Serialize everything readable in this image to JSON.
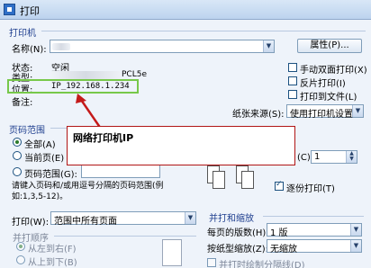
{
  "window": {
    "title": "打印"
  },
  "printer_group": {
    "title": "打印机",
    "name_label": "名称(N):",
    "properties_button": "属性(P)...",
    "status_label": "状态:",
    "status_value": "空闲",
    "type_label": "类型:",
    "type_value": "PCL5e",
    "where_label": "位置:",
    "where_value": "IP_192.168.1.234",
    "comment_label": "备注:",
    "checkboxes": [
      {
        "label": "手动双面打印(X)",
        "checked": false
      },
      {
        "label": "反片打印(I)",
        "checked": false
      },
      {
        "label": "打印到文件(L)",
        "checked": false
      }
    ],
    "paper_source_label": "纸张来源(S):",
    "paper_source_value": "使用打印机设置"
  },
  "annotation": {
    "text": "网络打印机IP"
  },
  "page_range": {
    "title": "页码范围",
    "all": "全部(A)",
    "current": "当前页(E)",
    "pages": "页码范围(G):",
    "hint": "请键入页码和/或用逗号分隔的页码范围(例如:1,3,5-12)。"
  },
  "copies": {
    "partial_label": "(C):",
    "value": "1",
    "collate": "逐份打印(T)"
  },
  "print_what": {
    "label": "打印(W):",
    "value": "范围中所有页面"
  },
  "order": {
    "title": "并打顺序",
    "ltr": "从左到右(F)",
    "ttb": "从上到下(B)"
  },
  "zoom": {
    "title": "并打和缩放",
    "pages_per_sheet_label": "每页的版数(H):",
    "pages_per_sheet_value": "1 版",
    "scale_label": "按纸型缩放(Z):",
    "scale_value": "无缩放",
    "draw_lines": "并打时绘制分隔线(D)"
  },
  "colors": {
    "accent": "#1f3f8f",
    "highlight": "#77c84a",
    "callout_border": "#b01515",
    "arrow": "#c41a1a"
  }
}
